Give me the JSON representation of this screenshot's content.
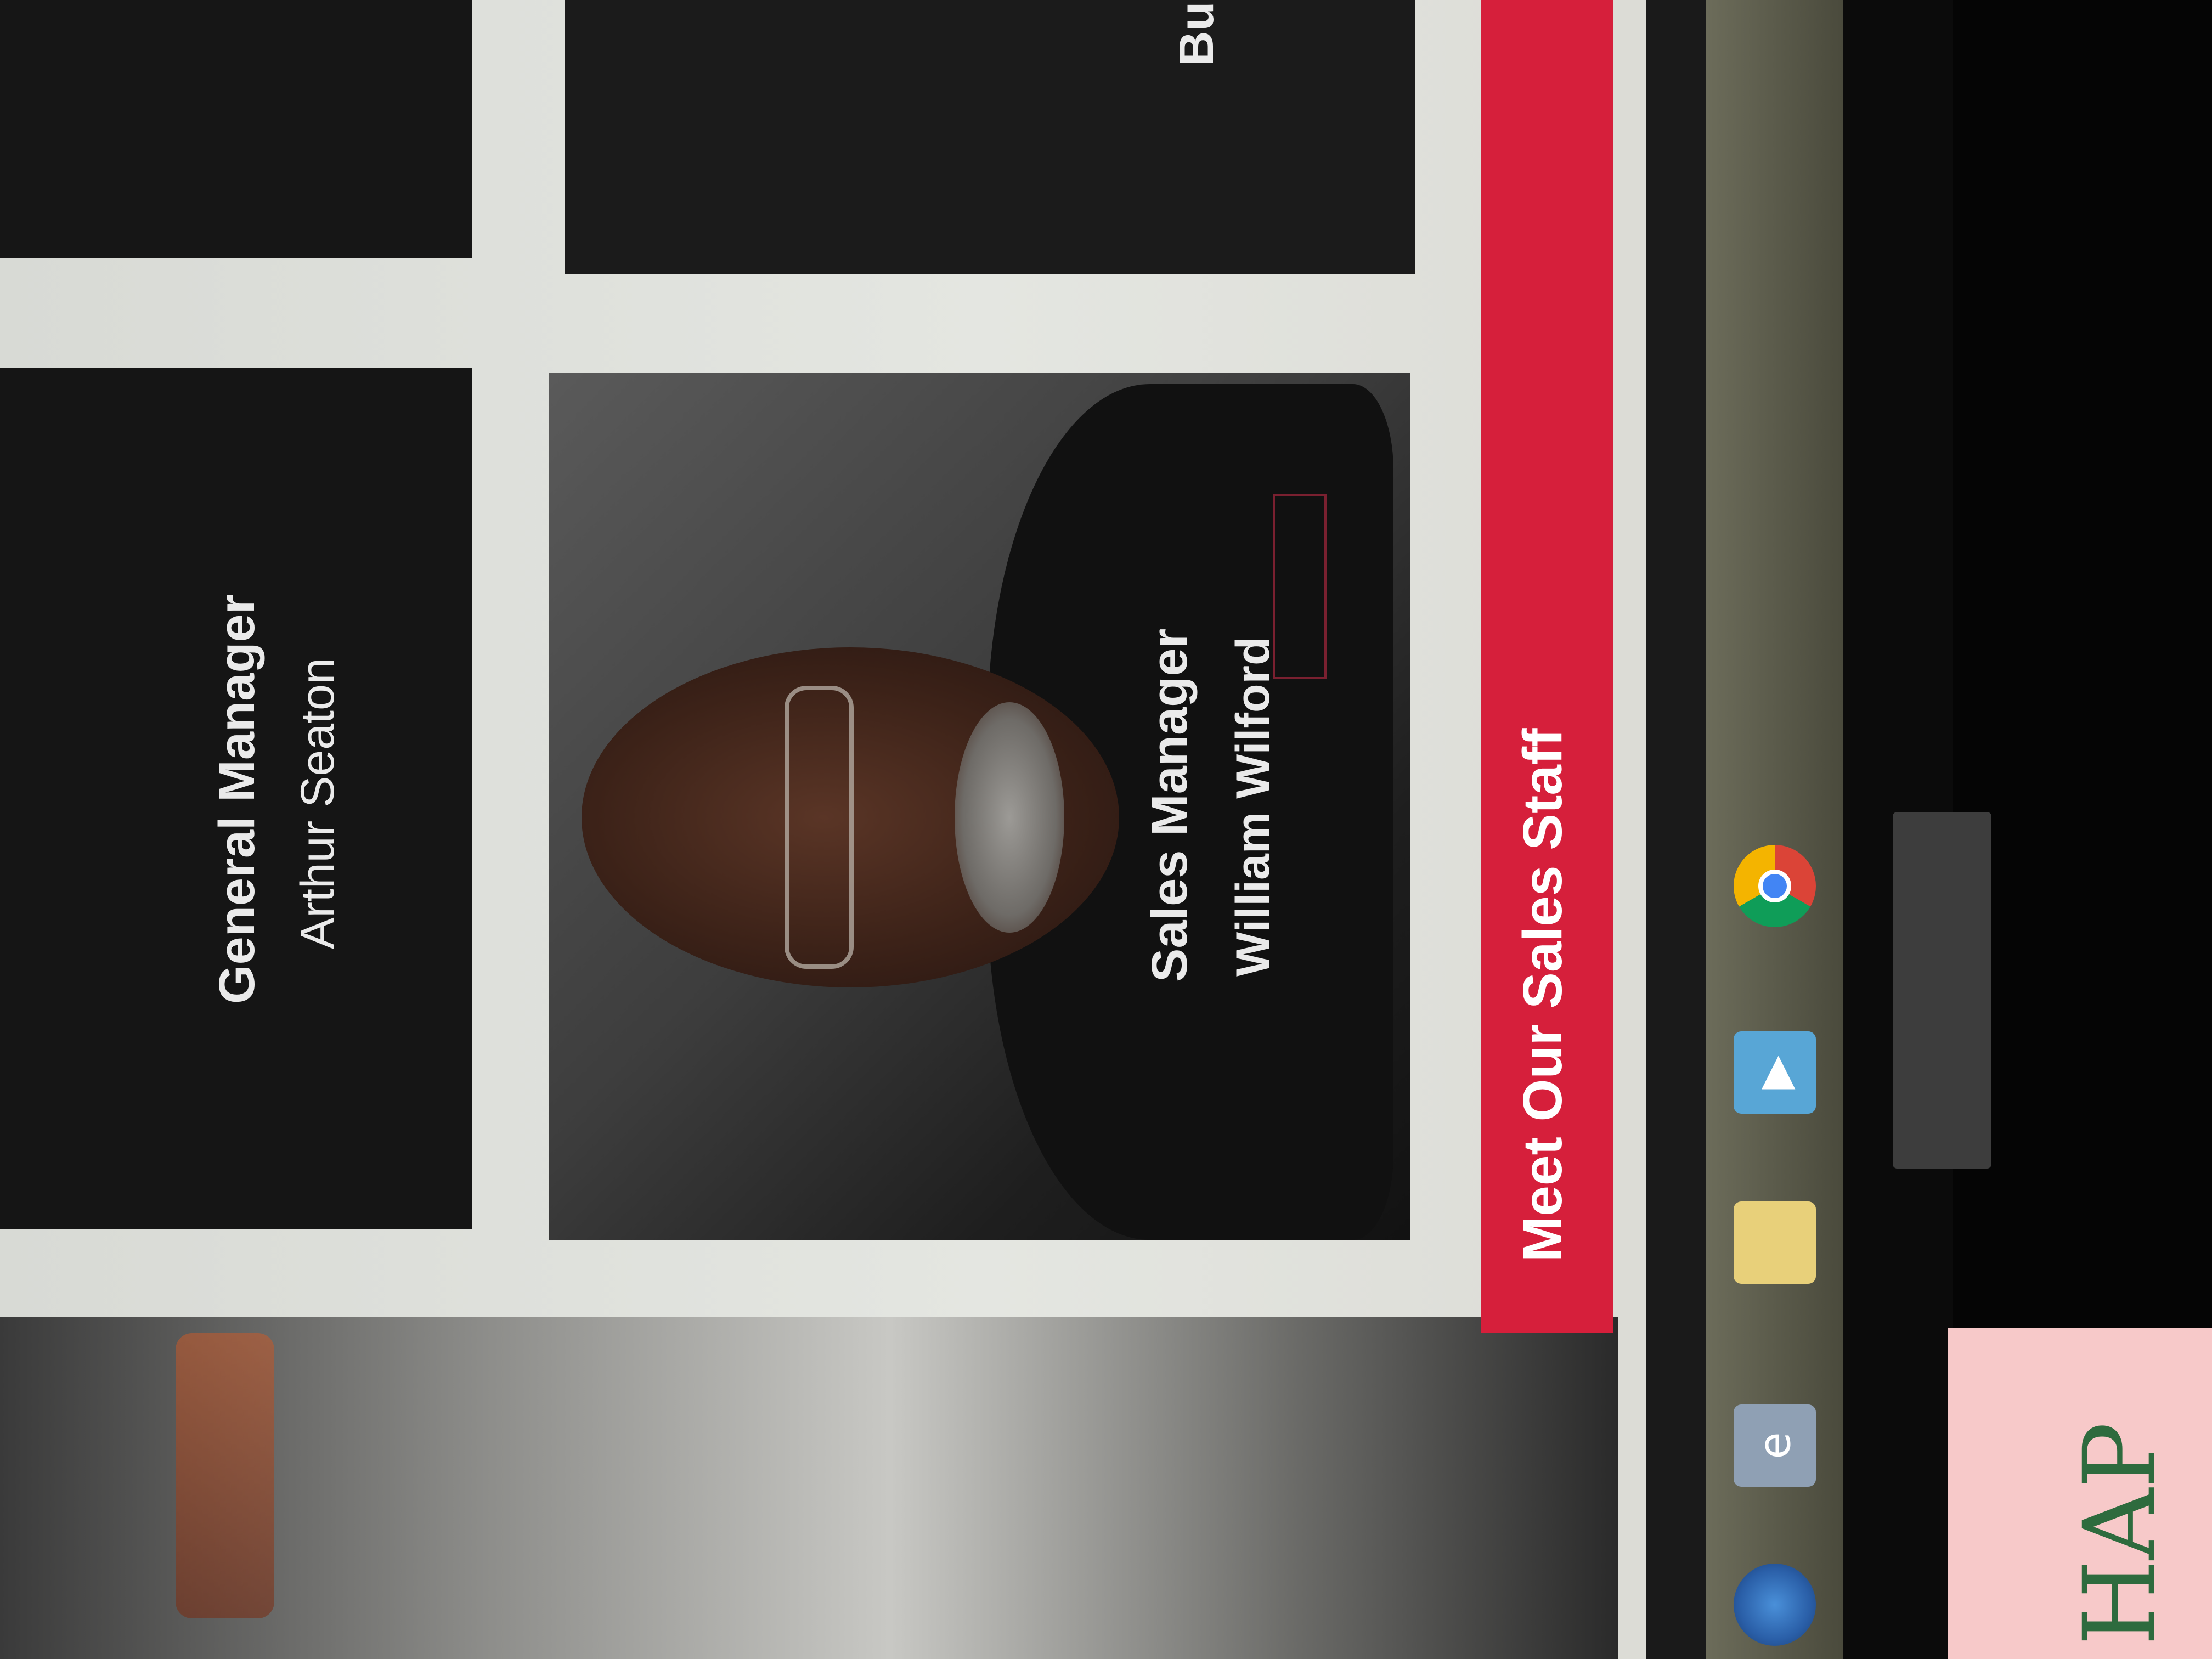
{
  "staff": {
    "general_manager": {
      "title": "General Manager",
      "name": "Arthur Seaton"
    },
    "sales_manager": {
      "title": "Sales Manager",
      "name": "William Wilford"
    },
    "partial_card_label": "Bu"
  },
  "section": {
    "heading": "Meet Our Sales Staff"
  },
  "colors": {
    "accent_red": "#d61f3b",
    "card_bg": "#131313",
    "text_light": "#eaeaea"
  },
  "taskbar": {
    "icons": [
      "windows-start-icon",
      "internet-explorer-icon",
      "file-explorer-icon",
      "media-player-icon",
      "chrome-icon"
    ]
  },
  "sticky_note": {
    "text": "HAP"
  }
}
